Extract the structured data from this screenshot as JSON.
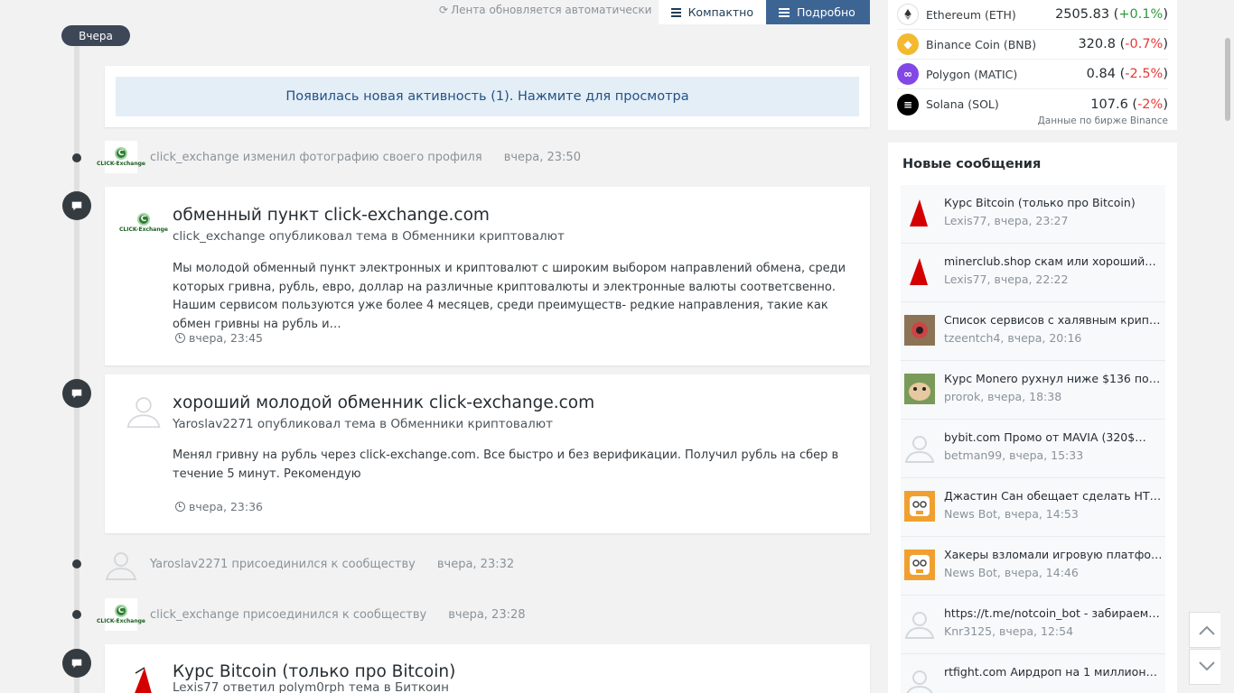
{
  "header": {
    "auto_refresh": "Лента обновляется автоматически",
    "view_compact": "Компактно",
    "view_detailed": "Подробно",
    "active_view": "Подробно"
  },
  "timeline": {
    "day_label": "Вчера",
    "new_activity": "Появилась новая активность (1). Нажмите для просмотра",
    "events": [
      {
        "user": "click_exchange",
        "action": "изменил фотографию своего профиля",
        "time": "вчера, 23:50"
      },
      {
        "title": "обменный пункт click-exchange.com",
        "meta": "click_exchange опубликовал тема в Обменники криптовалют",
        "body": "Мы молодой обменный пункт электронных и криптовалют с широким выбором направлений обмена, среди которых гривна, рубль, евро, доллар на различные криптовалюты и электронные валюты соответсвенно. Нашим сервисом пользуются уже более 4 месяцев, среди преимуществ- редкие направления, такие как обмен гривны на рубль и…",
        "time": "вчера, 23:45"
      },
      {
        "title": "хороший молодой обменник click-exchange.com",
        "meta": "Yaroslav2271 опубликовал тема в Обменники криптовалют",
        "body": "Менял гривну на рубль через click-exchange.com. Все быстро и без верификации. Получил рубль на сбер в течение 5 минут. Рекомендую",
        "time": "вчера, 23:36"
      },
      {
        "text": "Yaroslav2271 присоединился к сообществу",
        "time": "вчера, 23:32"
      },
      {
        "text": "click_exchange присоединился к сообществу",
        "time": "вчера, 23:28"
      },
      {
        "title": "Курс Bitcoin (только про Bitcoin)",
        "meta": "Lexis77 ответил polym0rph тема в Биткоин"
      }
    ],
    "logo_text": "CLICK-Exchange"
  },
  "crypto": {
    "rows": [
      {
        "name": "Ethereum (ETH)",
        "price": "2505.83",
        "change": "+0.1%",
        "icon_color": "#ffffff",
        "icon": "ethereum-icon"
      },
      {
        "name": "Binance Coin (BNB)",
        "price": "320.8",
        "change": "-0.7%",
        "icon_color": "#f3ba2f",
        "icon": "bnb-icon"
      },
      {
        "name": "Polygon (MATIC)",
        "price": "0.84",
        "change": "-2.5%",
        "icon_color": "#8247e5",
        "icon": "polygon-icon"
      },
      {
        "name": "Solana (SOL)",
        "price": "107.6",
        "change": "-2%",
        "icon_color": "#000000",
        "icon": "solana-icon"
      }
    ],
    "source": "Данные по бирже Binance",
    "up_color": "#2e9b3a",
    "down_color": "#e53935"
  },
  "new_messages": {
    "title": "Новые сообщения",
    "items": [
      {
        "title": "Курс Bitcoin (только про Bitcoin)",
        "meta": "Lexis77, вчера, 23:27",
        "avatar": "wizard-hat-avatar"
      },
      {
        "title": "minerclub.shop скам или хороший…",
        "meta": "Lexis77, вчера, 22:22",
        "avatar": "wizard-hat-avatar"
      },
      {
        "title": "Список сервисов с халявным крипт…",
        "meta": "tzeentch4, вчера, 20:16",
        "avatar": "photo-avatar"
      },
      {
        "title": "Курс Monero рухнул ниже $136 посл…",
        "meta": "prorok, вчера, 18:38",
        "avatar": "hamster-avatar"
      },
      {
        "title": "bybit.com Промо от MAVIA (320$…",
        "meta": "betman99, вчера, 15:33",
        "avatar": "default-avatar"
      },
      {
        "title": "Джастин Сан обещает сделать НТ…",
        "meta": "News Bot, вчера, 14:53",
        "avatar": "bot-avatar"
      },
      {
        "title": "Хакеры взломали игровую платфор…",
        "meta": "News Bot, вчера, 14:46",
        "avatar": "bot-avatar"
      },
      {
        "title": "https://t.me/notcoin_bot - забираем…",
        "meta": "Knr3125, вчера, 12:54",
        "avatar": "default-avatar"
      },
      {
        "title": "rtfight.com Аирдроп на 1 миллион…",
        "meta": "",
        "avatar": "default-avatar"
      }
    ]
  }
}
